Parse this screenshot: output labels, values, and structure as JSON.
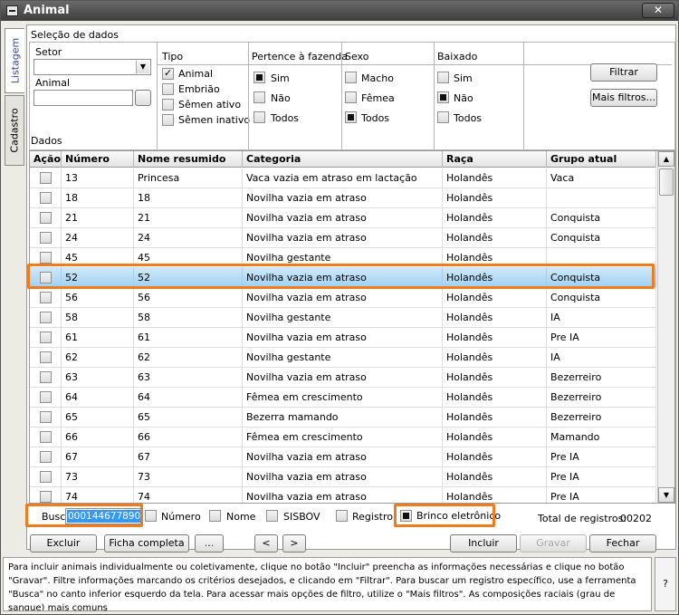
{
  "window": {
    "title": "Animal",
    "close_label": "✕"
  },
  "tabs": {
    "listagem": "Listagem",
    "cadastro": "Cadastro"
  },
  "selecao": {
    "title": "Seleção de dados",
    "setor_label": "Setor",
    "setor_value": "",
    "animal_label": "Animal",
    "animal_value": ""
  },
  "tipo": {
    "title": "Tipo",
    "options": [
      {
        "label": "Animal",
        "checked": true
      },
      {
        "label": "Embrião",
        "checked": false
      },
      {
        "label": "Sêmen ativo",
        "checked": false
      },
      {
        "label": "Sêmen inativo",
        "checked": false
      }
    ]
  },
  "pertence": {
    "title": "Pertence à fazenda",
    "options": [
      {
        "label": "Sim",
        "checked": true
      },
      {
        "label": "Não",
        "checked": false
      },
      {
        "label": "Todos",
        "checked": false
      }
    ]
  },
  "sexo": {
    "title": "Sexo",
    "options": [
      {
        "label": "Macho",
        "checked": false
      },
      {
        "label": "Fêmea",
        "checked": false
      },
      {
        "label": "Todos",
        "checked": true
      }
    ]
  },
  "baixado": {
    "title": "Baixado",
    "options": [
      {
        "label": "Sim",
        "checked": false
      },
      {
        "label": "Não",
        "checked": true
      },
      {
        "label": "Todos",
        "checked": false
      }
    ]
  },
  "buttons": {
    "filtrar": "Filtrar",
    "mais_filtros": "Mais filtros...",
    "excluir": "Excluir",
    "ficha_completa": "Ficha completa",
    "ellipsis": "...",
    "prev": "<",
    "next": ">",
    "incluir": "Incluir",
    "gravar": "Gravar",
    "fechar": "Fechar"
  },
  "dados": {
    "title": "Dados",
    "columns": [
      "Ação",
      "Número",
      "Nome resumido",
      "Categoria",
      "Raça",
      "Grupo atual"
    ],
    "rows": [
      [
        "13",
        "Princesa",
        "Vaca vazia em atraso em lactação",
        "Holandês",
        "Vaca"
      ],
      [
        "18",
        "18",
        "Novilha vazia em atraso",
        "Holandês",
        ""
      ],
      [
        "21",
        "21",
        "Novilha vazia em atraso",
        "Holandês",
        "Conquista"
      ],
      [
        "24",
        "24",
        "Novilha vazia em atraso",
        "Holandês",
        "Conquista"
      ],
      [
        "45",
        "45",
        "Novilha gestante",
        "Holandês",
        ""
      ],
      [
        "52",
        "52",
        "Novilha vazia em atraso",
        "Holandês",
        "Conquista"
      ],
      [
        "56",
        "56",
        "Novilha vazia em atraso",
        "Holandês",
        "Conquista"
      ],
      [
        "58",
        "58",
        "Novilha gestante",
        "Holandês",
        "IA"
      ],
      [
        "61",
        "61",
        "Novilha vazia em atraso",
        "Holandês",
        "Pre IA"
      ],
      [
        "62",
        "62",
        "Novilha gestante",
        "Holandês",
        "IA"
      ],
      [
        "63",
        "63",
        "Novilha vazia em atraso",
        "Holandês",
        "Bezerreiro"
      ],
      [
        "64",
        "64",
        "Fêmea em crescimento",
        "Holandês",
        "Bezerreiro"
      ],
      [
        "65",
        "65",
        "Bezerra mamando",
        "Holandês",
        "Bezerreiro"
      ],
      [
        "66",
        "66",
        "Fêmea em crescimento",
        "Holandês",
        "Mamando"
      ],
      [
        "67",
        "67",
        "Novilha vazia em atraso",
        "Holandês",
        "Pre IA"
      ],
      [
        "73",
        "73",
        "Novilha vazia em atraso",
        "Holandês",
        "Pre IA"
      ],
      [
        "74",
        "74",
        "Novilha vazia em atraso",
        "Holandês",
        "Pre IA"
      ]
    ],
    "selected_index": 5
  },
  "busca": {
    "label": "Busca:",
    "value": "000144677890",
    "options": [
      {
        "label": "Número",
        "checked": false
      },
      {
        "label": "Nome",
        "checked": false
      },
      {
        "label": "SISBOV",
        "checked": false
      },
      {
        "label": "Registro",
        "checked": false
      },
      {
        "label": "Brinco eletrônico",
        "checked": true
      }
    ],
    "total_label": "Total de registros:",
    "total_value": "00202"
  },
  "help": {
    "text": "Para incluir animais individualmente ou coletivamente, clique no botão \"Incluir\" preencha as informações necessárias e clique no botão \"Gravar\". Filtre informações marcando os critérios desejados, e clicando em \"Filtrar\". Para buscar um registro específico, use a ferramenta \"Busca\" no canto inferior esquerdo da tela. Para acessar mais opções de filtro, utilize o \"Mais filtros\". As composições raciais (grau de sangue) mais comuns",
    "q": "?"
  },
  "colors": {
    "highlight": "#f07a1e",
    "selection": "#9fd0f0",
    "busca_value_bg": "#3399ff"
  }
}
